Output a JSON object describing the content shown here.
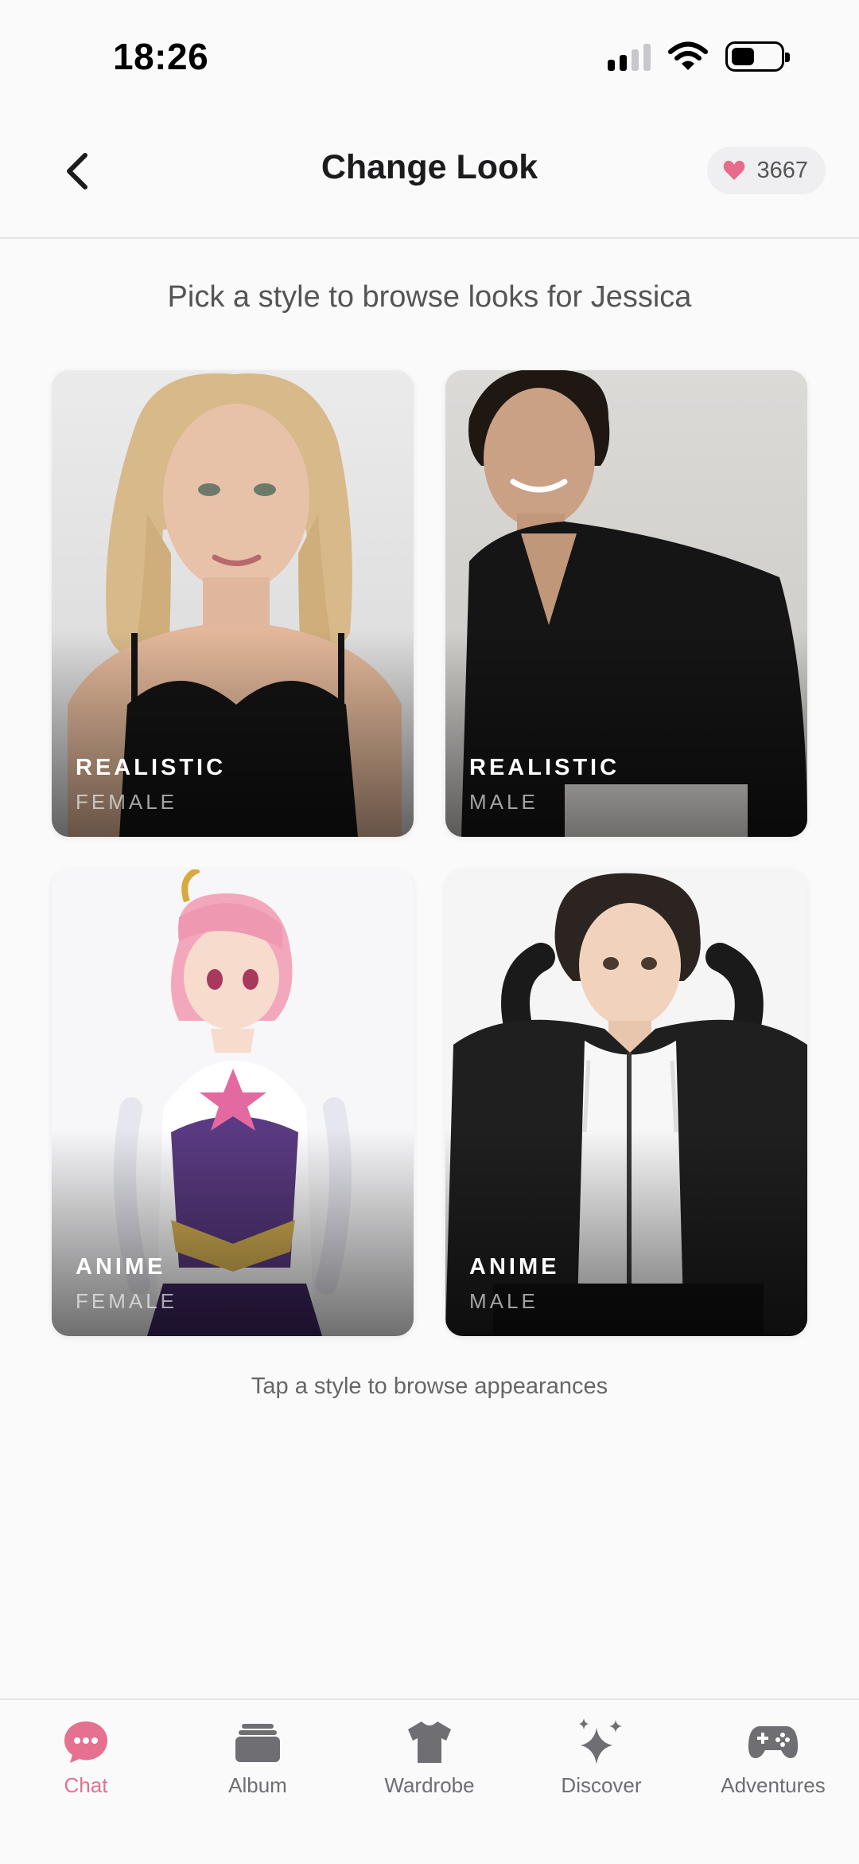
{
  "status_bar": {
    "time": "18:26"
  },
  "header": {
    "title": "Change Look",
    "credits": "3667"
  },
  "main": {
    "subtitle": "Pick a style to browse looks for Jessica",
    "cards": [
      {
        "label": "REALISTIC",
        "sub": "FEMALE"
      },
      {
        "label": "REALISTIC",
        "sub": "MALE"
      },
      {
        "label": "ANIME",
        "sub": "FEMALE"
      },
      {
        "label": "ANIME",
        "sub": "MALE"
      }
    ],
    "hint": "Tap a style to browse appearances"
  },
  "tabs": [
    {
      "label": "Chat",
      "icon": "chat-bubble-icon",
      "active": true
    },
    {
      "label": "Album",
      "icon": "album-icon"
    },
    {
      "label": "Wardrobe",
      "icon": "shirt-icon"
    },
    {
      "label": "Discover",
      "icon": "sparkles-icon"
    },
    {
      "label": "Adventures",
      "icon": "gamepad-icon"
    }
  ],
  "colors": {
    "accent": "#e5708f",
    "background": "#fafafa",
    "heart": "#e66b8c"
  }
}
